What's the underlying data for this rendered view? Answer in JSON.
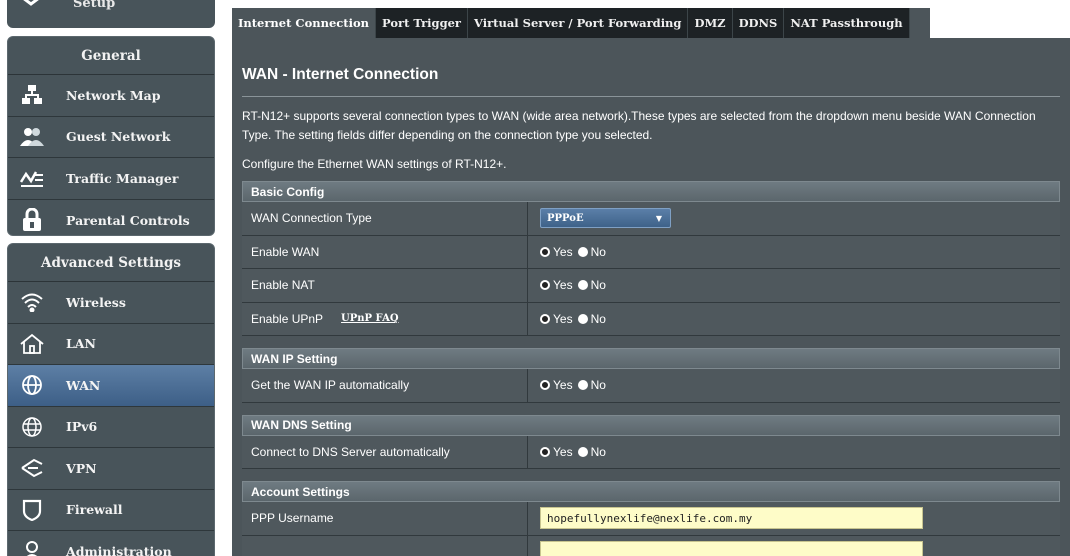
{
  "sidebar": {
    "setup_label": "Setup",
    "general_header": "General",
    "general_items": [
      {
        "label": "Network Map",
        "icon": "network-map-icon"
      },
      {
        "label": "Guest Network",
        "icon": "guest-network-icon"
      },
      {
        "label": "Traffic Manager",
        "icon": "traffic-manager-icon"
      },
      {
        "label": "Parental Controls",
        "icon": "parental-controls-icon"
      }
    ],
    "advanced_header": "Advanced Settings",
    "advanced_items": [
      {
        "label": "Wireless",
        "icon": "wireless-icon"
      },
      {
        "label": "LAN",
        "icon": "lan-icon"
      },
      {
        "label": "WAN",
        "icon": "wan-globe-icon",
        "active": true
      },
      {
        "label": "IPv6",
        "icon": "ipv6-icon"
      },
      {
        "label": "VPN",
        "icon": "vpn-icon"
      },
      {
        "label": "Firewall",
        "icon": "firewall-icon"
      },
      {
        "label": "Administration",
        "icon": "administration-icon"
      }
    ]
  },
  "tabs": [
    {
      "label": "Internet Connection",
      "active": true
    },
    {
      "label": "Port Trigger"
    },
    {
      "label": "Virtual Server / Port Forwarding"
    },
    {
      "label": "DMZ"
    },
    {
      "label": "DDNS"
    },
    {
      "label": "NAT Passthrough"
    }
  ],
  "page": {
    "title": "WAN - Internet Connection",
    "description": "RT-N12+ supports several connection types to WAN (wide area network).These types are selected from the dropdown menu beside WAN Connection Type. The setting fields differ depending on the connection type you selected.",
    "ethernet_note": "Configure the Ethernet WAN settings of RT-N12+."
  },
  "basic_config": {
    "header": "Basic Config",
    "wan_connection_type_label": "WAN Connection Type",
    "wan_connection_type_value": "PPPoE",
    "enable_wan_label": "Enable WAN",
    "enable_nat_label": "Enable NAT",
    "enable_upnp_label": "Enable UPnP",
    "upnp_faq_link": "UPnP  FAQ"
  },
  "wan_ip": {
    "header": "WAN IP Setting",
    "auto_ip_label": "Get the WAN IP automatically"
  },
  "wan_dns": {
    "header": "WAN DNS Setting",
    "auto_dns_label": "Connect to DNS Server automatically"
  },
  "account": {
    "header": "Account Settings",
    "username_label": "PPP Username",
    "username_value": "hopefullynexlife@nexlife.com.my"
  },
  "radio": {
    "yes": "Yes",
    "no": "No"
  },
  "colors": {
    "panel_bg": "#4c555a",
    "sidebar_bg": "#48545a",
    "active_item": "#4a6c93",
    "input_bg": "#fefcc8"
  }
}
